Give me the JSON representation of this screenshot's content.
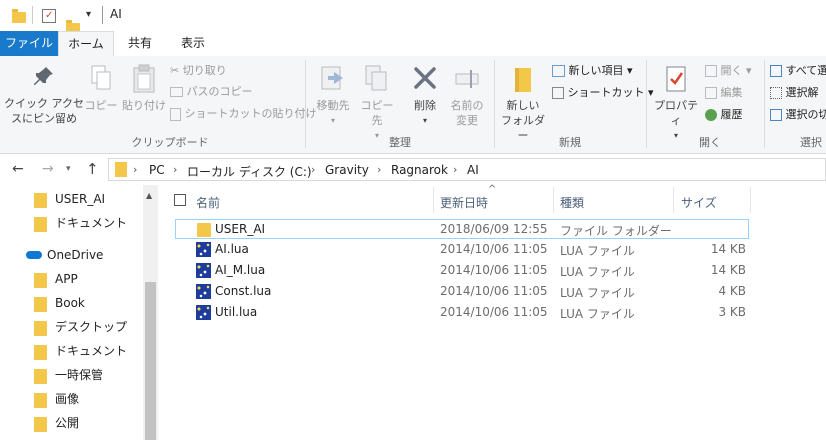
{
  "title_bar": {
    "path_title": "AI"
  },
  "ribbon_tabs": [
    "ファイル",
    "ホーム",
    "共有",
    "表示"
  ],
  "ribbon": {
    "clipboard": {
      "pin_label_1": "クイック アクセ",
      "pin_label_2": "スにピン留め",
      "copy": "コピー",
      "paste": "貼り付け",
      "cut": "切り取り",
      "copy_path": "パスのコピー",
      "paste_shortcut": "ショートカットの貼り付け",
      "group": "クリップボード"
    },
    "organize": {
      "move_to": "移動先",
      "copy_to": "コピー先",
      "delete": "削除",
      "rename_1": "名前の",
      "rename_2": "変更",
      "group": "整理"
    },
    "new": {
      "new_item": "新しい項目 ▾",
      "shortcut": "ショートカット ▾",
      "new_folder_1": "新しい",
      "new_folder_2": "フォルダー",
      "group": "新規"
    },
    "open": {
      "properties": "プロパティ",
      "open": "開く ▾",
      "edit": "編集",
      "history": "履歴",
      "group": "開く"
    },
    "select": {
      "select_all": "すべて選",
      "select_none": "選択解",
      "invert": "選択の切",
      "group": "選択"
    }
  },
  "address": {
    "crumbs": [
      "PC",
      "ローカル ディスク (C:)",
      "Gravity",
      "Ragnarok",
      "AI"
    ]
  },
  "sidebar": {
    "items": [
      "USER_AI",
      "ドキュメント",
      "OneDrive",
      "APP",
      "Book",
      "デスクトップ",
      "ドキュメント",
      "一時保管",
      "画像",
      "公開"
    ]
  },
  "columns": {
    "name": "名前",
    "date": "更新日時",
    "type": "種類",
    "size": "サイズ"
  },
  "files": [
    {
      "name": "USER_AI",
      "date": "2018/06/09 12:55",
      "type": "ファイル フォルダー",
      "size": ""
    },
    {
      "name": "AI.lua",
      "date": "2014/10/06 11:05",
      "type": "LUA ファイル",
      "size": "14 KB"
    },
    {
      "name": "AI_M.lua",
      "date": "2014/10/06 11:05",
      "type": "LUA ファイル",
      "size": "14 KB"
    },
    {
      "name": "Const.lua",
      "date": "2014/10/06 11:05",
      "type": "LUA ファイル",
      "size": "4 KB"
    },
    {
      "name": "Util.lua",
      "date": "2014/10/06 11:05",
      "type": "LUA ファイル",
      "size": "3 KB"
    }
  ],
  "icons": [
    "folder-icon",
    "properties-check-icon",
    "pin-icon",
    "copy-icon",
    "paste-icon",
    "scissors-icon",
    "move-to-icon",
    "copy-to-icon",
    "delete-x-icon",
    "rename-icon",
    "new-folder-icon",
    "new-item-icon",
    "shortcut-icon",
    "properties-icon",
    "open-icon",
    "edit-icon",
    "history-icon",
    "select-all-icon",
    "onedrive-cloud-icon",
    "lua-file-icon",
    "back-arrow-icon",
    "forward-arrow-icon",
    "up-arrow-icon"
  ],
  "colors": {
    "file_tab": "#1979ca",
    "selection_border": "#99d1ff",
    "folder": "#f3c84a",
    "onedrive": "#0f78d4"
  }
}
